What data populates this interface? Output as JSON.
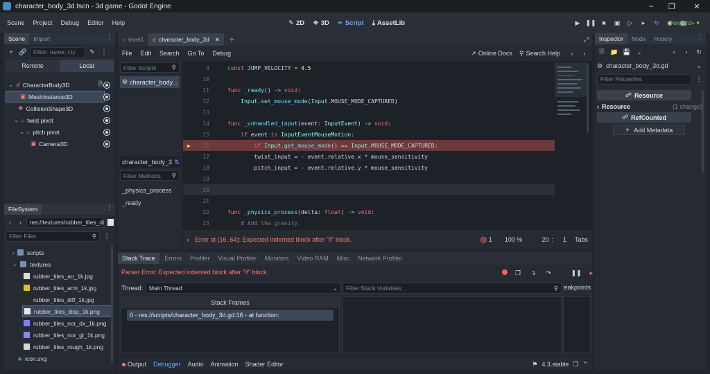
{
  "window": {
    "title": "character_body_3d.tscn - 3d game - Godot Engine"
  },
  "menu": [
    "Scene",
    "Project",
    "Debug",
    "Editor",
    "Help"
  ],
  "workspaces": [
    {
      "label": "2D",
      "icon": "2d-icon"
    },
    {
      "label": "3D",
      "icon": "3d-icon"
    },
    {
      "label": "Script",
      "icon": "script-icon"
    },
    {
      "label": "AssetLib",
      "icon": "assetlib-icon"
    }
  ],
  "renderer": "Forward+",
  "scene_panel": {
    "tabs": [
      "Scene",
      "Import"
    ],
    "filter_placeholder": "Filter: name, t:ty",
    "remote": "Remote",
    "local": "Local",
    "nodes": [
      {
        "name": "CharacterBody3D"
      },
      {
        "name": "MeshInstance3D"
      },
      {
        "name": "CollisionShape3D"
      },
      {
        "name": "twist pivot"
      },
      {
        "name": "pitch pivot"
      },
      {
        "name": "Camera3D"
      }
    ]
  },
  "filesystem": {
    "tab": "FileSystem",
    "path": "res://textures/rubber_tiles_di",
    "filter_placeholder": "Filter Files",
    "items": [
      {
        "name": "scripts"
      },
      {
        "name": "textures"
      },
      {
        "name": "rubber_tiles_ao_1k.jpg",
        "color": "#dcdcdc"
      },
      {
        "name": "rubber_tiles_arm_1k.jpg",
        "color": "#e0c020"
      },
      {
        "name": "rubber_tiles_diff_1k.jpg",
        "color": "#2a2a2a"
      },
      {
        "name": "rubber_tiles_disp_1k.png",
        "color": "#e8e8e8"
      },
      {
        "name": "rubber_tiles_nor_dx_1k.png",
        "color": "#8080ff"
      },
      {
        "name": "rubber_tiles_nor_gl_1k.png",
        "color": "#8a86f0"
      },
      {
        "name": "rubber_tiles_rough_1k.png",
        "color": "#d6d6d6"
      },
      {
        "name": "icon.svg"
      }
    ]
  },
  "script_tabs": [
    {
      "label": "level1"
    },
    {
      "label": "character_body_3d"
    }
  ],
  "script_menu": [
    "File",
    "Edit",
    "Search",
    "Go To",
    "Debug"
  ],
  "online_docs": "Online Docs",
  "search_help": "Search Help",
  "filter_scripts": "Filter Scripts",
  "script_list": [
    "character_body..."
  ],
  "method_header": "character_body_3",
  "filter_methods": "Filter Methods",
  "methods": [
    "_physics_process",
    "_ready"
  ],
  "code": {
    "lines": [
      {
        "n": "9",
        "t": "const JUMP_VELOCITY = 4.5"
      },
      {
        "n": "10",
        "t": ""
      },
      {
        "n": "11",
        "t": "func _ready() -> void:"
      },
      {
        "n": "12",
        "t": "    Input.set_mouse_mode(Input.MOUSE_MODE_CAPTURED)"
      },
      {
        "n": "13",
        "t": ""
      },
      {
        "n": "14",
        "t": "func _unhandled_input(event: InputEvent) -> void:"
      },
      {
        "n": "15",
        "t": "    if event is InputEventMouseMotion:"
      },
      {
        "n": "16",
        "t": "        if Input.get_mouse_mode() == Input.MOUSE_MODE_CAPTURED:"
      },
      {
        "n": "17",
        "t": "        twist_input = - event.relative.x * mouse_sensitivity"
      },
      {
        "n": "18",
        "t": "        pitch_input = - event.relative.y * mouse_sensitivity"
      },
      {
        "n": "19",
        "t": ""
      },
      {
        "n": "20",
        "t": ""
      },
      {
        "n": "21",
        "t": ""
      },
      {
        "n": "22",
        "t": "func _physics_process(delta: float) -> void:"
      },
      {
        "n": "23",
        "t": "    # Add the gravity."
      }
    ]
  },
  "status": {
    "error": "Error at (16, 64): Expected indented block after \"if\" block.",
    "error_count": "1",
    "zoom": "100 %",
    "line": "20",
    "sep": ":",
    "col": "1",
    "indent": "Tabs"
  },
  "bottom_tabs": [
    "Stack Trace",
    "Errors",
    "Profiler",
    "Visual Profiler",
    "Monitors",
    "Video RAM",
    "Misc",
    "Network Profiler"
  ],
  "debugger": {
    "parser_error": "Parser Error: Expected indented block after \"if\" block.",
    "thread_label": "Thread:",
    "thread_value": "Main Thread",
    "filter_stack": "Filter Stack Variables",
    "stack_frames": "Stack Frames",
    "frame0": "0 - res://scripts/character_body_3d.gd:16 - at function:",
    "breakpoints": "Breakpoints"
  },
  "bottom_bar": {
    "tabs": [
      "Output",
      "Debugger",
      "Audio",
      "Animation",
      "Shader Editor"
    ],
    "version": "4.3.stable"
  },
  "inspector": {
    "tabs": [
      "Inspector",
      "Node",
      "History"
    ],
    "file": "character_body_3d.gd",
    "filter_placeholder": "Filter Properties",
    "resource_header": "Resource",
    "resource": "Resource",
    "change": "(1 change)",
    "refcounted": "RefCounted",
    "add_metadata": "Add Metadata"
  },
  "colors": {
    "accent": "#6ea8ff",
    "error": "#ff786b",
    "error_line": "#6b3a3a",
    "ok": "#8fd36a"
  }
}
